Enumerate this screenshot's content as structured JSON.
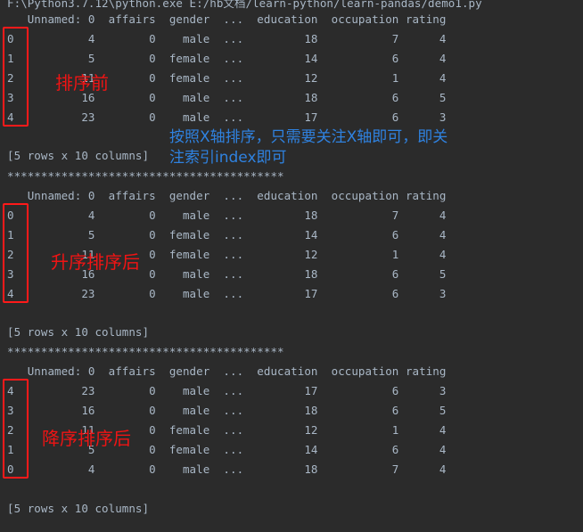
{
  "console": {
    "background_color": "#2b2b2b",
    "text_color": "#a9b7c6",
    "annotation_red": "#f01414",
    "annotation_blue": "#2f82e0",
    "command_line": "F:\\Python3.7.12\\python.exe E:/hb文档/learn-python/learn-pandas/demo1.py",
    "separator": "*****************************************",
    "summary_line": "[5 rows x 10 columns]",
    "header_line": "   Unnamed: 0  affairs  gender  ...  education  occupation rating",
    "columns": [
      "Unnamed: 0",
      "affairs",
      "gender",
      "...",
      "education",
      "occupation",
      "rating"
    ],
    "blocks": [
      {
        "name": "before-sort",
        "annotation": "排序前",
        "rows": [
          "0           4        0    male  ...         18           7      4",
          "1           5        0  female  ...         14           6      4",
          "2          11        0  female  ...         12           1      4",
          "3          16        0    male  ...         18           6      5",
          "4          23        0    male  ...         17           6      3"
        ],
        "index": [
          "0",
          "1",
          "2",
          "3",
          "4"
        ]
      },
      {
        "name": "ascending-sort",
        "annotation": "升序排序后",
        "rows": [
          "0           4        0    male  ...         18           7      4",
          "1           5        0  female  ...         14           6      4",
          "2          11        0  female  ...         12           1      4",
          "3          16        0    male  ...         18           6      5",
          "4          23        0    male  ...         17           6      3"
        ],
        "index": [
          "0",
          "1",
          "2",
          "3",
          "4"
        ]
      },
      {
        "name": "descending-sort",
        "annotation": "降序排序后",
        "rows": [
          "4          23        0    male  ...         17           6      3",
          "3          16        0    male  ...         18           6      5",
          "2          11        0  female  ...         12           1      4",
          "1           5        0  female  ...         14           6      4",
          "0           4        0    male  ...         18           7      4"
        ],
        "index": [
          "4",
          "3",
          "2",
          "1",
          "0"
        ]
      }
    ],
    "blue_annotation": {
      "line1": "按照X轴排序，只需要关注X轴即可，即关",
      "line2": "注索引index即可"
    }
  }
}
